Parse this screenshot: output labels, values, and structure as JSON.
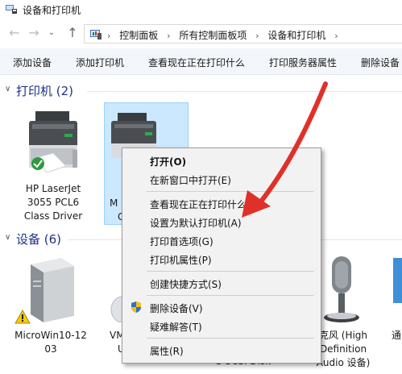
{
  "window": {
    "title": "设备和打印机",
    "icon": "devices-printers-icon"
  },
  "navigation": {
    "back_icon": "arrow-left-icon",
    "forward_icon": "arrow-right-icon",
    "recent_icon": "chevron-down-icon",
    "up_icon": "arrow-up-icon",
    "breadcrumbs": [
      "控制面板",
      "所有控制面板项",
      "设备和打印机"
    ],
    "separator": "›"
  },
  "toolbar": {
    "items": [
      "添加设备",
      "添加打印机",
      "查看现在正在打印什么",
      "打印服务器属性",
      "删除设备"
    ]
  },
  "printers_section": {
    "label": "打印机 (2)",
    "items": [
      {
        "line1": "HP LaserJet",
        "line2": "3055 PCL6",
        "line3": "Class Driver"
      },
      {
        "line1": "M",
        "line2": "C"
      }
    ]
  },
  "devices_section": {
    "label": "设备 (6)",
    "items": [
      {
        "line1": "MicroWin10-12",
        "line2": "03"
      },
      {
        "line1": "VM",
        "line2": "U"
      },
      {
        "line1": "S SCSI Disk",
        "line2": ""
      },
      {
        "line1": "克风 (High",
        "line2": "Definition",
        "line3": "Audio 设备)"
      },
      {
        "line1": "通"
      }
    ]
  },
  "context_menu": {
    "items": [
      {
        "label": "打开(O)",
        "bold": true
      },
      {
        "label": "在新窗口中打开(E)"
      },
      {
        "label": "查看现在正在打印什么(E)"
      },
      {
        "label": "设置为默认打印机(A)"
      },
      {
        "label": "打印首选项(G)"
      },
      {
        "label": "打印机属性(P)"
      },
      {
        "label": "创建快捷方式(S)"
      },
      {
        "label": "删除设备(V)",
        "icon": "uac-shield-icon"
      },
      {
        "label": "疑难解答(T)"
      },
      {
        "label": "属性(R)"
      }
    ]
  },
  "annotation": {
    "arrow_color": "#e0302a"
  },
  "colors": {
    "section_header": "#1e3287",
    "selection": "#cce8ff",
    "command_bar": "#f3f6fb"
  }
}
